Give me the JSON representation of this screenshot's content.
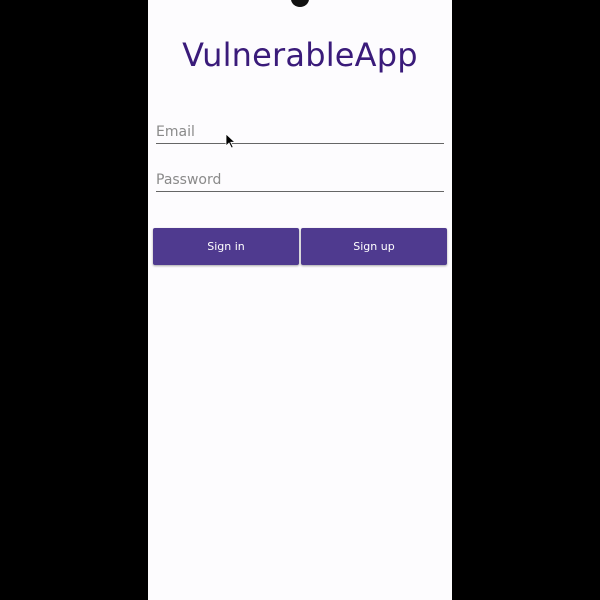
{
  "app": {
    "title": "VulnerableApp"
  },
  "form": {
    "email_placeholder": "Email",
    "email_value": "",
    "password_placeholder": "Password",
    "password_value": ""
  },
  "buttons": {
    "sign_in_label": "Sign in",
    "sign_up_label": "Sign up"
  },
  "colors": {
    "title": "#3a1b7a",
    "button": "#4f3a8f",
    "background": "#fdfcfe"
  },
  "icons": {
    "pointer": "mouse-pointer-icon",
    "camera": "camera-notch"
  }
}
